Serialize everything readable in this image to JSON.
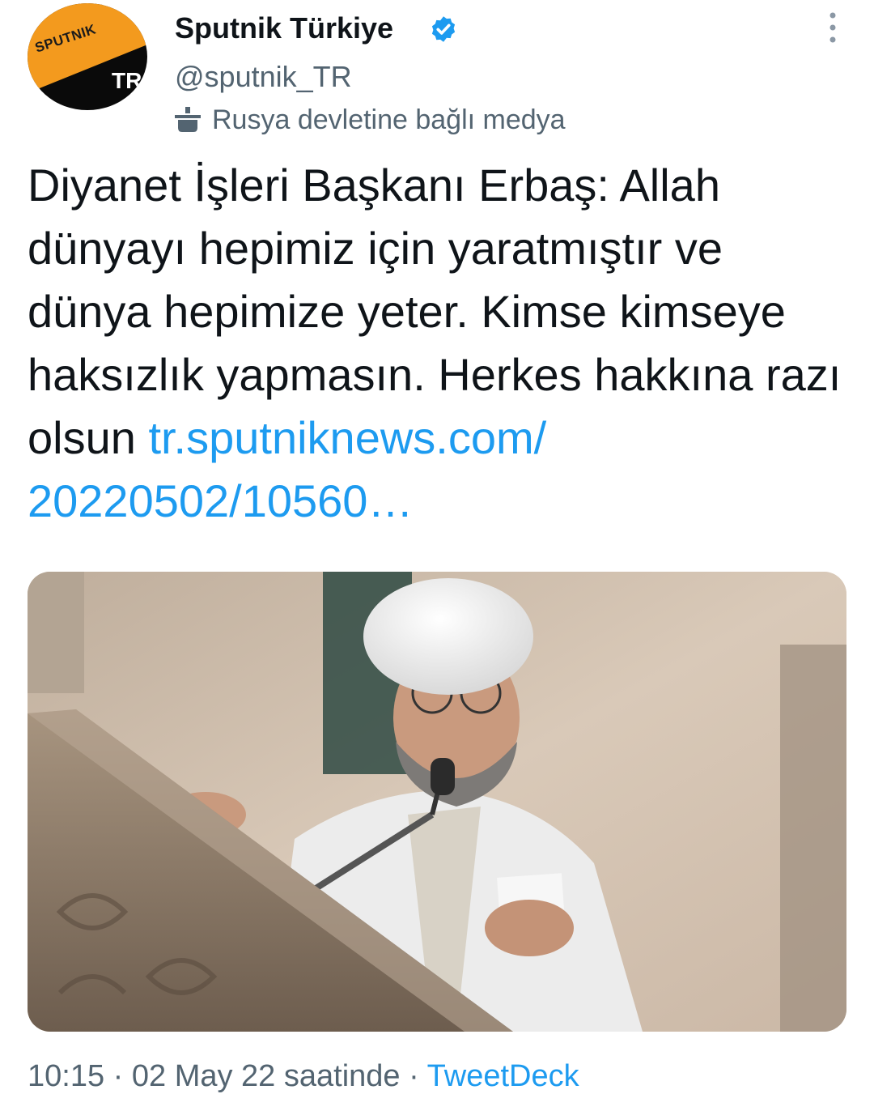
{
  "tweet": {
    "author_name": "Sputnik Türkiye",
    "author_handle": "@sputnik_TR",
    "verified": true,
    "affiliation_label": "Rusya devletine bağlı medya",
    "text": "Diyanet İşleri Başkanı Erbaş: Allah dünyayı hepimiz için yaratmıştır ve dünya hepimize yeter. Kimse kimseye haksızlık yapmasın. Herkes hakkına razı olsun",
    "link_text": "tr.sputniknews.com/​20220502/10560…",
    "time": "10:15",
    "separator": "·",
    "date": "02 May 22 saatinde",
    "source": "TweetDeck"
  },
  "avatar": {
    "brand_text": "SPUTNIK",
    "badge_text": "TR",
    "colors": {
      "bg": "#0a0a0a",
      "accent": "#f39a1e"
    }
  },
  "icons": {
    "verified": "verified-badge-icon",
    "affiliation": "state-media-icon",
    "more": "more-options-icon"
  },
  "colors": {
    "text": "#0f1419",
    "secondary": "#536471",
    "link": "#1d9bf0"
  }
}
